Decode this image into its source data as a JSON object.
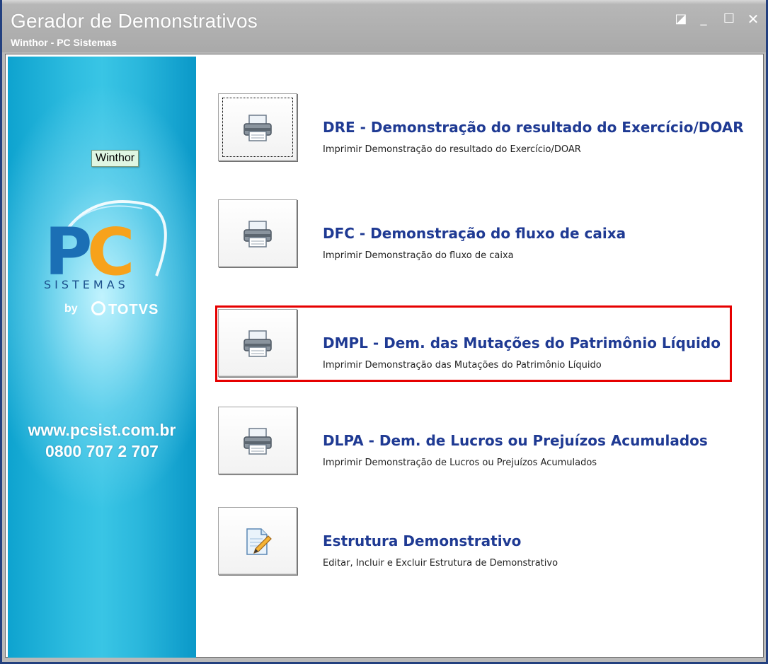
{
  "window": {
    "title": "Gerador de Demonstrativos",
    "subtitle": "Winthor - PC Sistemas",
    "controls": {
      "restore": "◪",
      "minimize": "_",
      "maximize": "☐",
      "close": "✕"
    }
  },
  "sidebar": {
    "tooltip": "Winthor",
    "logo": {
      "mark": "PC",
      "sistemas": "SISTEMAS",
      "by": "by",
      "totvs": "TOTVS"
    },
    "website": "www.pcsist.com.br",
    "phone": "0800 707 2 707"
  },
  "options": [
    {
      "title": "DRE - Demonstração do resultado do Exercício/DOAR",
      "description": "Imprimir Demonstração do resultado do Exercício/DOAR",
      "icon": "printer-icon"
    },
    {
      "title": "DFC - Demonstração do fluxo de caixa",
      "description": "Imprimir Demonstração do fluxo de caixa",
      "icon": "printer-icon"
    },
    {
      "title": "DMPL - Dem. das Mutações do Patrimônio Líquido",
      "description": "Imprimir Demonstração das Mutações do Patrimônio Líquido",
      "icon": "printer-icon"
    },
    {
      "title": "DLPA - Dem. de Lucros ou Prejuízos Acumulados",
      "description": "Imprimir Demonstração de Lucros ou Prejuízos Acumulados",
      "icon": "printer-icon"
    },
    {
      "title": "Estrutura Demonstrativo",
      "description": "Editar, Incluir e Excluir Estrutura de Demonstrativo",
      "icon": "edit-document-icon"
    }
  ],
  "colors": {
    "title_blue": "#1f3a93",
    "highlight_red": "#e60000",
    "sidebar_cyan": "#2fbde0",
    "logo_orange": "#f7a21b",
    "logo_blue": "#1b6fb5"
  }
}
